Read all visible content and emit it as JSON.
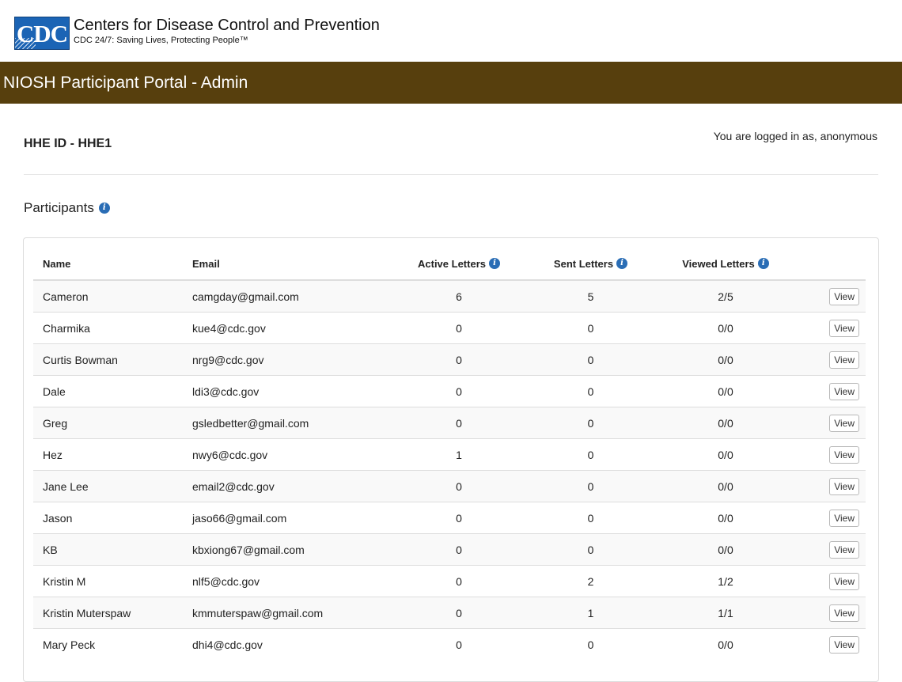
{
  "header": {
    "logo_text": "CDC",
    "org_name": "Centers for Disease Control and Prevention",
    "tagline": "CDC 24/7: Saving Lives, Protecting People™"
  },
  "title_bar": {
    "title": "NIOSH Participant Portal - Admin"
  },
  "hhe": {
    "label": "HHE ID - HHE1"
  },
  "user": {
    "status": "You are logged in as, anonymous"
  },
  "participants": {
    "title": "Participants",
    "columns": {
      "name": "Name",
      "email": "Email",
      "active": "Active Letters",
      "sent": "Sent Letters",
      "viewed": "Viewed Letters"
    },
    "view_label": "View",
    "rows": [
      {
        "name": "Cameron",
        "email": "camgday@gmail.com",
        "active": "6",
        "sent": "5",
        "viewed": "2/5"
      },
      {
        "name": "Charmika",
        "email": "kue4@cdc.gov",
        "active": "0",
        "sent": "0",
        "viewed": "0/0"
      },
      {
        "name": "Curtis Bowman",
        "email": "nrg9@cdc.gov",
        "active": "0",
        "sent": "0",
        "viewed": "0/0"
      },
      {
        "name": "Dale",
        "email": "ldi3@cdc.gov",
        "active": "0",
        "sent": "0",
        "viewed": "0/0"
      },
      {
        "name": "Greg",
        "email": "gsledbetter@gmail.com",
        "active": "0",
        "sent": "0",
        "viewed": "0/0"
      },
      {
        "name": "Hez",
        "email": "nwy6@cdc.gov",
        "active": "1",
        "sent": "0",
        "viewed": "0/0"
      },
      {
        "name": "Jane Lee",
        "email": "email2@cdc.gov",
        "active": "0",
        "sent": "0",
        "viewed": "0/0"
      },
      {
        "name": "Jason",
        "email": "jaso66@gmail.com",
        "active": "0",
        "sent": "0",
        "viewed": "0/0"
      },
      {
        "name": "KB",
        "email": "kbxiong67@gmail.com",
        "active": "0",
        "sent": "0",
        "viewed": "0/0"
      },
      {
        "name": "Kristin M",
        "email": "nlf5@cdc.gov",
        "active": "0",
        "sent": "2",
        "viewed": "1/2"
      },
      {
        "name": "Kristin Muterspaw",
        "email": "kmmuterspaw@gmail.com",
        "active": "0",
        "sent": "1",
        "viewed": "1/1"
      },
      {
        "name": "Mary Peck",
        "email": "dhi4@cdc.gov",
        "active": "0",
        "sent": "0",
        "viewed": "0/0"
      }
    ]
  },
  "icons": {
    "info": "info-circle-icon"
  },
  "colors": {
    "title_bar": "#573f0d",
    "logo_blue": "#1b64b5",
    "info_blue": "#2a6db5"
  }
}
